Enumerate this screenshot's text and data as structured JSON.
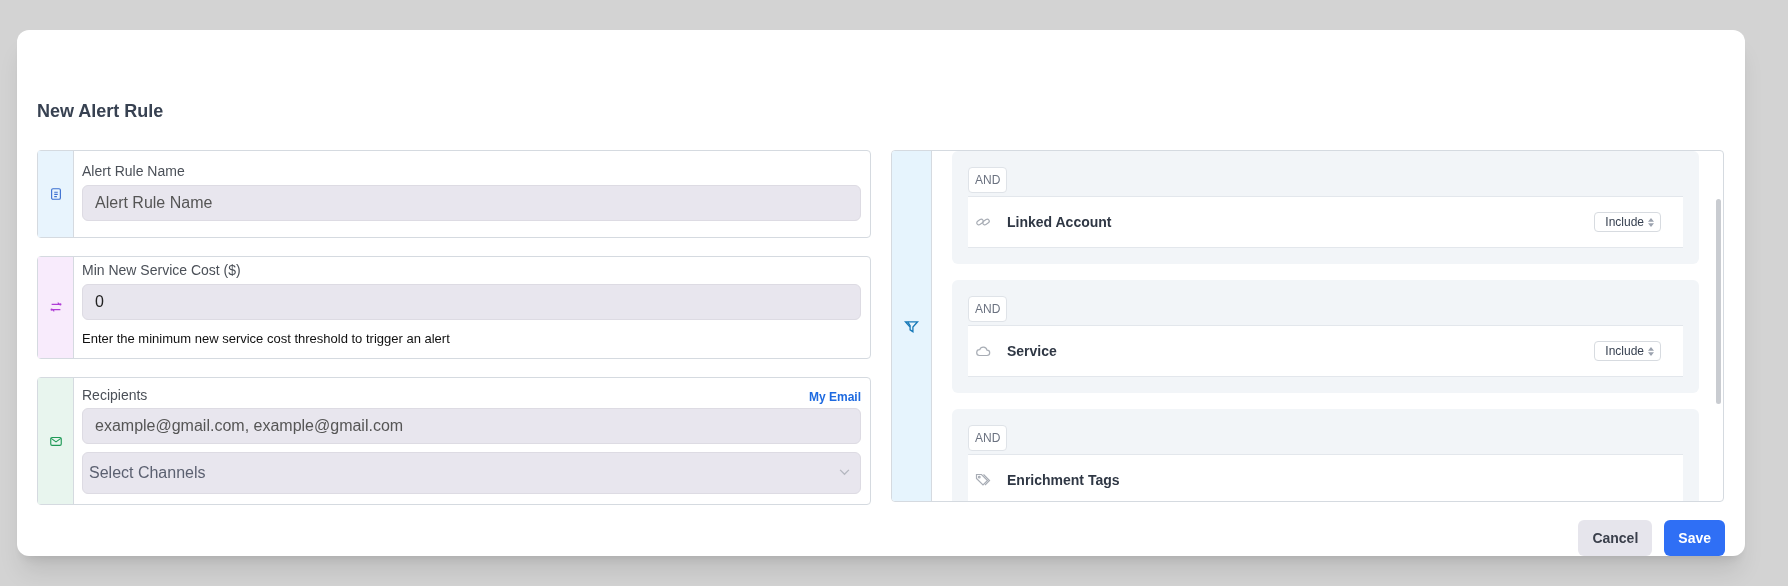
{
  "dialog": {
    "title": "New Alert Rule"
  },
  "fields": [
    {
      "kind": "text",
      "label": "Alert Rule Name",
      "placeholder": "Alert Rule Name",
      "color": "#e8f4fd"
    },
    {
      "kind": "number",
      "label": "Min New Service Cost ($)",
      "value": "0",
      "help": "Enter the minimum new service cost threshold to trigger an alert",
      "color": "#f8ebfc"
    },
    {
      "kind": "recipients",
      "label": "Recipients",
      "link": "My Email",
      "placeholder": "example@gmail.com, example@gmail.com",
      "select_placeholder": "Select Channels",
      "color": "#e8f5ee"
    }
  ],
  "filters": [
    {
      "operator": "AND",
      "kind": "link",
      "label": "Linked Account",
      "mode": "Include"
    },
    {
      "operator": "AND",
      "kind": "cloud",
      "label": "Service",
      "mode": "Include"
    },
    {
      "operator": "AND",
      "kind": "tag",
      "label": "Enrichment Tags"
    }
  ],
  "buttons": [
    {
      "kind": "secondary",
      "label": "Cancel"
    },
    {
      "kind": "primary",
      "label": "Save"
    }
  ]
}
